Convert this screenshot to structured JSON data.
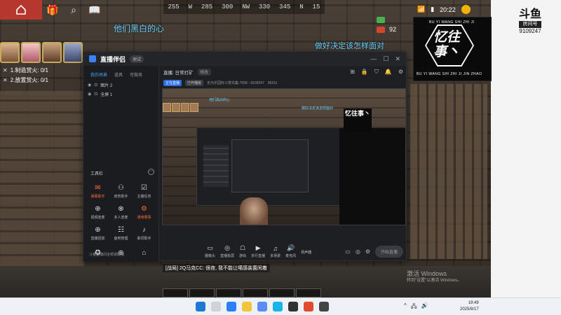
{
  "hud": {
    "compass": [
      "255",
      "W",
      "285",
      "300",
      "NW",
      "330",
      "345",
      "N",
      "15"
    ],
    "time": "20:22",
    "health_value": "92"
  },
  "overlay": {
    "line1": "他们黑白的心",
    "line2": "做好决定该怎样面对"
  },
  "quests": [
    {
      "text": "1.制造赏火: 0/1"
    },
    {
      "text": "2.放置赏火: 0/1"
    }
  ],
  "logo_box": {
    "top_text": "BU YI WANG SHI   ZHI JI",
    "main_text": "忆往事丶",
    "sub_text": "BU YI WANG SHI   ZHI JI JIN ZHAO"
  },
  "douyu": {
    "brand": "斗鱼",
    "tag": "房间号",
    "room": "9109247"
  },
  "app": {
    "name": "直播伴侣",
    "tag": "测试",
    "left_tabs": [
      "我的场景",
      "道具",
      "可做卖"
    ],
    "scenes": [
      "图片 2",
      "全屏 1"
    ],
    "tools_title": "工具栏",
    "tools": [
      {
        "label": "弹幕助手",
        "icon": "✉",
        "hl": true
      },
      {
        "label": "房管助手",
        "icon": "⚇",
        "hl": false
      },
      {
        "label": "主播任务",
        "icon": "☑",
        "hl": false
      },
      {
        "label": "视频连麦",
        "icon": "⊕",
        "hl": false
      },
      {
        "label": "多人连麦",
        "icon": "⊗",
        "hl": false
      },
      {
        "label": "通用赛事",
        "icon": "⚙",
        "hl": true
      },
      {
        "label": "直播回放",
        "icon": "⊕",
        "hl": false
      },
      {
        "label": "鱼吧管理",
        "icon": "☷",
        "hl": false
      },
      {
        "label": "歌词助手",
        "icon": "♪",
        "hl": false
      },
      {
        "label": "",
        "icon": "✪",
        "hl": false
      },
      {
        "label": "",
        "icon": "⊕",
        "hl": false
      },
      {
        "label": "",
        "icon": "⌂",
        "hl": false
      }
    ],
    "left_footer": "斗鱼直播间全频道联播",
    "header": {
      "title": "直播: 日常打矿",
      "chip": "修改"
    },
    "sub": {
      "btn1": "正在直播",
      "btn2": "已开播房",
      "info": "无为乐园好斗宠鸟集-7058 - 9109247",
      "count": "95151"
    },
    "preview": {
      "text1": "他们黑白的心",
      "text2": "做好决定该怎样面对",
      "logo": "忆往事丶"
    },
    "bottom_tools": [
      {
        "label": "摄像头",
        "icon": "▭",
        "red": false
      },
      {
        "label": "直播投屏",
        "icon": "◎",
        "red": false
      },
      {
        "label": "游戏",
        "icon": "☖",
        "red": false
      },
      {
        "label": "多行直播",
        "icon": "▶",
        "red": false
      },
      {
        "label": "多场景",
        "icon": "♫",
        "red": false
      },
      {
        "label": "麦克风",
        "icon": "🔊",
        "red": true
      },
      {
        "label": "扬声器",
        "icon": "",
        "red": false
      }
    ],
    "go_live": "开始直播"
  },
  "chat": "[战局] 2Q马克CC: 很夜, 我不能让噶感装置闲着",
  "watermark": {
    "line1": "激活 Windows",
    "line2": "转到\"设置\"以激活 Windows。"
  },
  "taskbar": {
    "time": "19:49",
    "date": "2025/8/17"
  },
  "colors": {
    "hud_red": "#b5372d",
    "overlay_text": "#6fd3ff",
    "accent_orange": "#ff6a3d",
    "app_blue": "#3b82f6"
  }
}
